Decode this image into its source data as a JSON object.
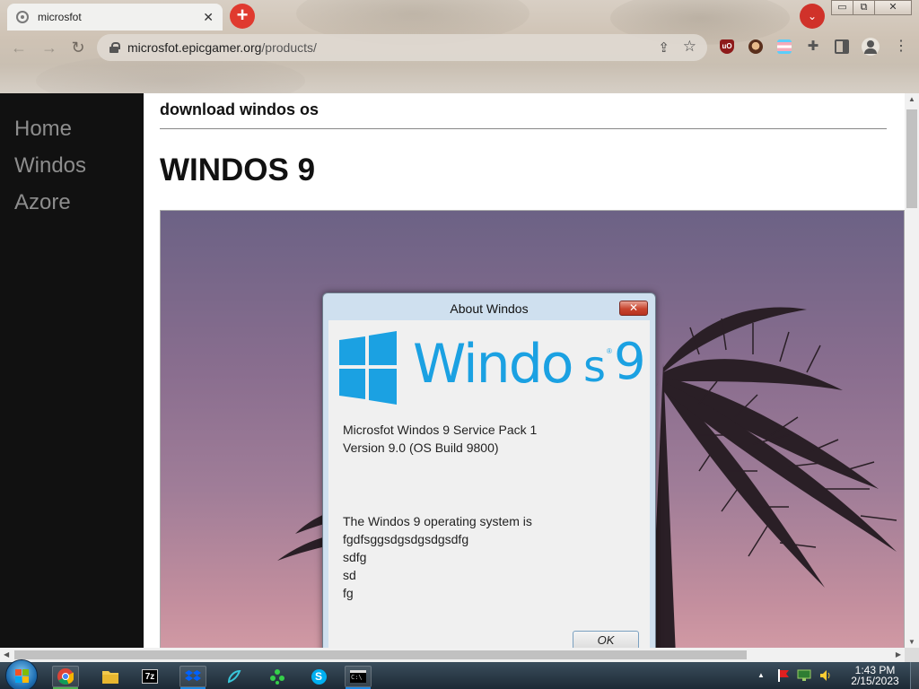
{
  "browser": {
    "tab": {
      "title": "microsfot",
      "close": "✕"
    },
    "new_tab": "+",
    "tab_search": "⌄",
    "window_buttons": {
      "minimize": "▭",
      "restore": "⧉",
      "close": "✕"
    },
    "nav": {
      "back": "←",
      "forward": "→",
      "reload": "↻"
    },
    "url": {
      "domain": "microsfot.epicgamer.org",
      "path": "/products/"
    },
    "icons": {
      "share": "⇪",
      "star": "☆",
      "ublock": "uO",
      "puzzle": "✚",
      "menu": "⋮"
    }
  },
  "sidebar": {
    "items": [
      {
        "label": "Home"
      },
      {
        "label": "Windos"
      },
      {
        "label": "Azore"
      }
    ]
  },
  "main": {
    "subtitle": "download windos os",
    "heading": "WINDOS 9"
  },
  "dialog": {
    "title": "About Windos",
    "close": "✕",
    "logo": {
      "word_part1": "Windo",
      "word_part2": "s",
      "version": "9",
      "reg": "®"
    },
    "line1": "Microsfot Windos 9 Service Pack 1",
    "line2": "Version 9.0 (OS Build 9800)",
    "desc": [
      "The Windos 9 operating system is",
      "fgdfsggsdgsdgsdgsdfg",
      "sdfg",
      "sd",
      "fg"
    ],
    "ok": "OK"
  },
  "scroll": {
    "up": "▲",
    "down": "▼",
    "left": "◀",
    "right": "▶"
  },
  "taskbar": {
    "tray_arrow": "▲",
    "time": "1:43 PM",
    "date": "2/15/2023",
    "icons": [
      "chrome-icon",
      "folder-icon",
      "7zip-icon",
      "dropbox-icon",
      "paint-icon",
      "grid-icon",
      "skype-icon",
      "cmd-icon"
    ],
    "label_7z": "7z",
    "label_skype": "S",
    "label_cmd": "C:\\"
  },
  "colors": {
    "win_blue": "#1ba1e2",
    "sidebar_bg": "#111111",
    "sidebar_text": "#8d8d8d",
    "new_tab_red": "#e03a2f"
  }
}
